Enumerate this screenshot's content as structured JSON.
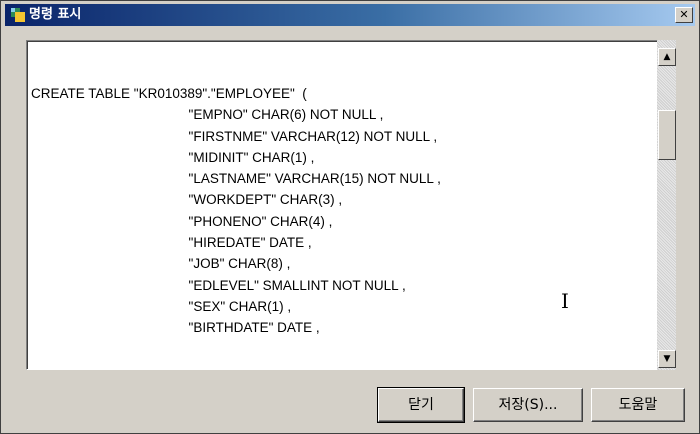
{
  "window": {
    "title": "명령 표시"
  },
  "close_glyph": "✕",
  "code_lines": [
    "CREATE TABLE \"KR010389\".\"EMPLOYEE\"  (",
    "                                          \"EMPNO\" CHAR(6) NOT NULL ,",
    "                                          \"FIRSTNME\" VARCHAR(12) NOT NULL ,",
    "                                          \"MIDINIT\" CHAR(1) ,",
    "                                          \"LASTNAME\" VARCHAR(15) NOT NULL ,",
    "                                          \"WORKDEPT\" CHAR(3) ,",
    "                                          \"PHONENO\" CHAR(4) ,",
    "                                          \"HIREDATE\" DATE ,",
    "                                          \"JOB\" CHAR(8) ,",
    "                                          \"EDLEVEL\" SMALLINT NOT NULL ,",
    "                                          \"SEX\" CHAR(1) ,",
    "                                          \"BIRTHDATE\" DATE ,"
  ],
  "buttons": {
    "close": "닫기",
    "save": "저장(S)...",
    "help": "도움말"
  },
  "icons": {
    "window_icon": "app-icon",
    "scroll_up": "up-arrow-icon",
    "scroll_down": "down-arrow-icon",
    "cursor": "text-cursor-icon"
  }
}
